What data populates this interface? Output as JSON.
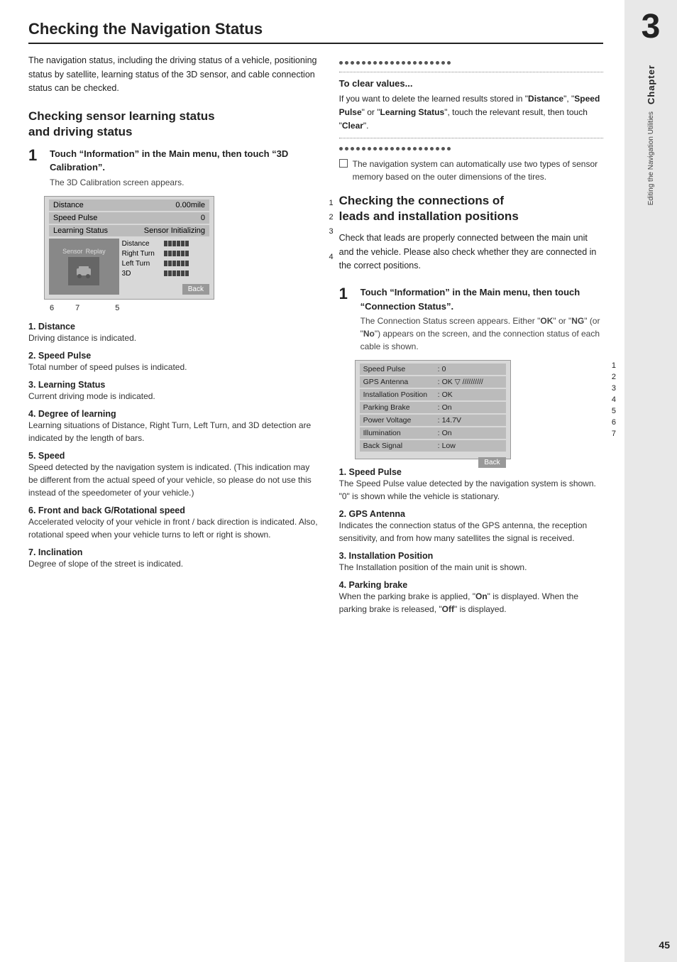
{
  "page": {
    "title": "Checking the Navigation Status",
    "page_number": "45"
  },
  "sidebar": {
    "chapter_num": "3",
    "chapter_label": "Chapter",
    "subtitle": "Editing the Navigation Utilities"
  },
  "left_column": {
    "intro_text": "The navigation status, including the driving status of a vehicle, positioning status by satellite, learning status of the 3D sensor, and cable connection status can be checked.",
    "section1_title": "Checking sensor learning status\nand driving status",
    "step1_title": "Touch “Information” in the Main menu, then touch “3D Calibration”.",
    "step1_sub": "The 3D Calibration screen appears.",
    "screen_rows": [
      {
        "label": "Distance",
        "value": "0.00mile"
      },
      {
        "label": "Speed Pulse",
        "value": "0"
      },
      {
        "label": "Learning Status",
        "value": "Sensor Initializing"
      }
    ],
    "screen_back_label": "Back",
    "diagram_labels": [
      "6",
      "7",
      "5"
    ],
    "num_items": [
      {
        "num": "1",
        "title": "Distance",
        "desc": "Driving distance is indicated."
      },
      {
        "num": "2",
        "title": "Speed Pulse",
        "desc": "Total number of speed pulses is indicated."
      },
      {
        "num": "3",
        "title": "Learning Status",
        "desc": "Current driving mode is indicated."
      },
      {
        "num": "4",
        "title": "Degree of learning",
        "desc": "Learning situations of Distance, Right Turn, Left Turn, and 3D detection are indicated by the length of bars."
      },
      {
        "num": "5",
        "title": "Speed",
        "desc": "Speed detected by the navigation system is indicated. (This indication may be different from the actual speed of your vehicle, so please do not use this instead of the speedometer of your vehicle.)"
      },
      {
        "num": "6",
        "title": "Front and back G/Rotational speed",
        "desc": "Accelerated velocity of your vehicle in front / back direction is indicated. Also, rotational speed when your vehicle turns to left or right is shown."
      },
      {
        "num": "7",
        "title": "Inclination",
        "desc": "Degree of slope of the street is indicated."
      }
    ]
  },
  "right_column": {
    "clear_values_title": "To clear values...",
    "clear_values_text": "If you want to delete the learned results stored in “Distance”, “Speed Pulse” or “Learning Status”, touch the relevant result, then touch “Clear”.",
    "note_text": "The navigation system can automatically use two types of sensor memory based on the outer dimensions of the tires.",
    "section2_title": "Checking the connections of\nleads and installation positions",
    "section2_intro": "Check that leads are properly connected between the main unit and the vehicle. Please also check whether they are connected in the correct positions.",
    "step2_title": "Touch “Information” in the Main menu, then touch “Connection Status”.",
    "step2_sub": "The Connection Status screen appears. Either “OK” or “NG” (or “No”) appears on the screen, and the connection status of each cable is shown.",
    "conn_rows": [
      {
        "label": "Speed Pulse",
        "sep": ":",
        "value": "0"
      },
      {
        "label": "GPS Antenna",
        "sep": ":",
        "value": "OK ▽ ///////////"
      },
      {
        "label": "Installation Position",
        "sep": ":",
        "value": "OK"
      },
      {
        "label": "Parking Brake",
        "sep": ":",
        "value": "On"
      },
      {
        "label": "Power Voltage",
        "sep": ":",
        "value": "14.7V"
      },
      {
        "label": "Illumination",
        "sep": ":",
        "value": "On"
      },
      {
        "label": "Back Signal",
        "sep": ":",
        "value": "Low"
      }
    ],
    "conn_back_label": "Back",
    "conn_num_items": [
      {
        "num": "1",
        "title": "Speed Pulse",
        "desc": "The Speed Pulse value detected by the navigation system is shown. “0” is shown while the vehicle is stationary."
      },
      {
        "num": "2",
        "title": "GPS Antenna",
        "desc": "Indicates the connection status of the GPS antenna, the reception sensitivity, and from how many satellites the signal is received."
      },
      {
        "num": "3",
        "title": "Installation Position",
        "desc": "The Installation position of the main unit is shown."
      },
      {
        "num": "4",
        "title": "Parking brake",
        "desc": "When the parking brake is applied, “On” is displayed. When the parking brake is released, “Off” is displayed."
      }
    ]
  }
}
